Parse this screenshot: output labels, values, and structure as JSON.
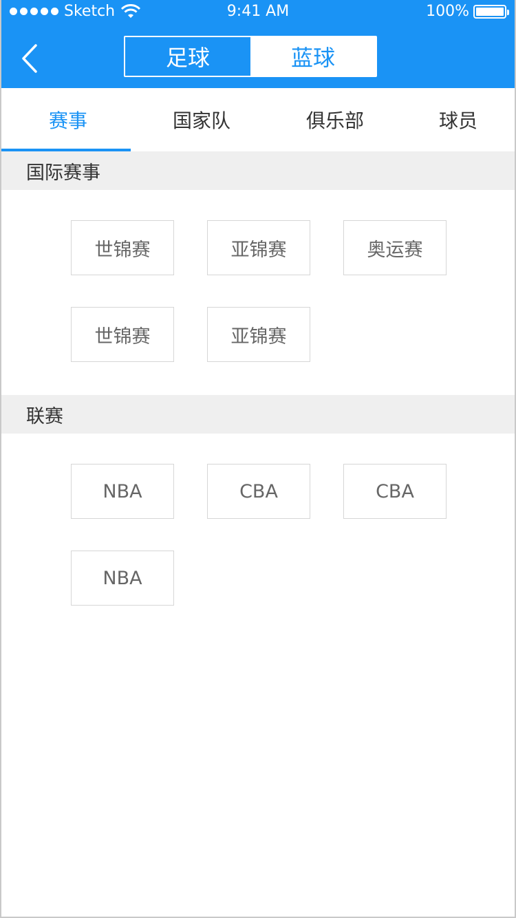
{
  "status_bar": {
    "carrier": "Sketch",
    "time": "9:41 AM",
    "battery": "100%"
  },
  "nav": {
    "segments": [
      {
        "label": "足球",
        "active": false
      },
      {
        "label": "蓝球",
        "active": true
      }
    ]
  },
  "tabs": [
    {
      "label": "赛事",
      "active": true
    },
    {
      "label": "国家队",
      "active": false
    },
    {
      "label": "俱乐部",
      "active": false
    },
    {
      "label": "球员",
      "active": false
    }
  ],
  "sections": [
    {
      "title": "国际赛事",
      "items": [
        "世锦赛",
        "亚锦赛",
        "奥运赛",
        "世锦赛",
        "亚锦赛"
      ]
    },
    {
      "title": "联赛",
      "items": [
        "NBA",
        "CBA",
        "CBA",
        "NBA"
      ]
    }
  ],
  "colors": {
    "accent": "#1a93f5",
    "section_bg": "#efefef",
    "chip_text": "#666666"
  },
  "icons": [
    "signal-dots-icon",
    "wifi-icon",
    "battery-icon",
    "chevron-left-icon"
  ]
}
